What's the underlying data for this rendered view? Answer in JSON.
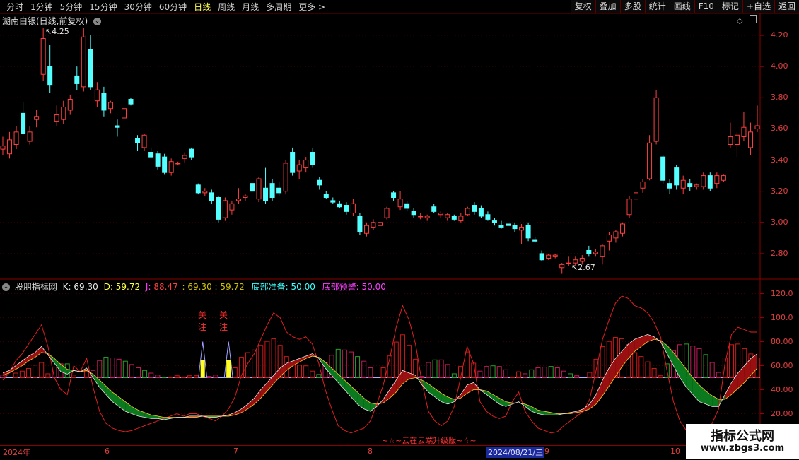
{
  "toolbar": {
    "left_items": [
      "分时",
      "1分钟",
      "5分钟",
      "15分钟",
      "30分钟",
      "60分钟",
      "日线",
      "周线",
      "月线",
      "多周期",
      "更多 >"
    ],
    "active_index": 6,
    "right_items": [
      "复权",
      "叠加",
      "多股",
      "统计",
      "画线",
      "F10",
      "标记",
      "+自选",
      "返回"
    ]
  },
  "main_chart": {
    "title": "湖南白银(日线,前复权)",
    "y_ticks": [
      "4.20",
      "4.00",
      "3.80",
      "3.60",
      "3.40",
      "3.20",
      "3.00",
      "2.80"
    ],
    "y_range": [
      2.65,
      4.3
    ],
    "high_mark": "4.25",
    "low_mark": "2.67",
    "colors": {
      "up": "#ff4040",
      "down": "#54ffff"
    }
  },
  "indicator": {
    "name": "股朋指标网",
    "k_label": "K:",
    "k_value": "69.30",
    "d_label": "D:",
    "d_value": "59.72",
    "j_label": "J:",
    "j_value": "88.47",
    "extra": ": 69.30 : 59.72",
    "bottom_prep_label": "底部准备:",
    "bottom_prep_value": "50.00",
    "bottom_warn_label": "底部预警:",
    "bottom_warn_value": "50.00",
    "y_ticks": [
      "120.0",
      "100.0",
      "80.00",
      "60.00",
      "40.00",
      "20.00"
    ],
    "y_range": [
      -5,
      128
    ],
    "signal_text": "关注",
    "footer_text": "~☆~云在云端升级版~☆~"
  },
  "date_axis": {
    "labels": [
      "2024年",
      "6",
      "7",
      "8",
      "9",
      "10"
    ],
    "highlight": "2024/08/21/三"
  },
  "watermark": {
    "title": "指标公式网",
    "url": "www.zbgs3.com"
  },
  "chart_data": {
    "type": "candlestick",
    "series": [
      {
        "o": 3.47,
        "h": 3.55,
        "l": 3.43,
        "c": 3.49
      },
      {
        "o": 3.44,
        "h": 3.58,
        "l": 3.41,
        "c": 3.53
      },
      {
        "o": 3.5,
        "h": 3.62,
        "l": 3.47,
        "c": 3.58
      },
      {
        "o": 3.7,
        "h": 3.77,
        "l": 3.56,
        "c": 3.57
      },
      {
        "o": 3.52,
        "h": 3.62,
        "l": 3.5,
        "c": 3.58
      },
      {
        "o": 3.66,
        "h": 3.72,
        "l": 3.61,
        "c": 3.68
      },
      {
        "o": 3.95,
        "h": 4.25,
        "l": 3.91,
        "c": 4.18
      },
      {
        "o": 4.0,
        "h": 4.14,
        "l": 3.83,
        "c": 3.88
      },
      {
        "o": 3.65,
        "h": 3.75,
        "l": 3.62,
        "c": 3.69
      },
      {
        "o": 3.66,
        "h": 3.78,
        "l": 3.63,
        "c": 3.74
      },
      {
        "o": 3.72,
        "h": 3.82,
        "l": 3.69,
        "c": 3.79
      },
      {
        "o": 3.94,
        "h": 4.0,
        "l": 3.85,
        "c": 3.89
      },
      {
        "o": 3.87,
        "h": 4.25,
        "l": 3.84,
        "c": 4.19
      },
      {
        "o": 4.11,
        "h": 4.2,
        "l": 3.85,
        "c": 3.87
      },
      {
        "o": 3.78,
        "h": 3.9,
        "l": 3.74,
        "c": 3.85
      },
      {
        "o": 3.83,
        "h": 3.87,
        "l": 3.68,
        "c": 3.72
      },
      {
        "o": 3.73,
        "h": 3.78,
        "l": 3.7,
        "c": 3.77
      },
      {
        "o": 3.62,
        "h": 3.66,
        "l": 3.55,
        "c": 3.61
      },
      {
        "o": 3.67,
        "h": 3.75,
        "l": 3.62,
        "c": 3.73
      },
      {
        "o": 3.79,
        "h": 3.8,
        "l": 3.75,
        "c": 3.76
      },
      {
        "o": 3.54,
        "h": 3.56,
        "l": 3.46,
        "c": 3.51
      },
      {
        "o": 3.48,
        "h": 3.57,
        "l": 3.46,
        "c": 3.56
      },
      {
        "o": 3.45,
        "h": 3.48,
        "l": 3.41,
        "c": 3.42
      },
      {
        "o": 3.44,
        "h": 3.46,
        "l": 3.34,
        "c": 3.36
      },
      {
        "o": 3.42,
        "h": 3.44,
        "l": 3.31,
        "c": 3.32
      },
      {
        "o": 3.32,
        "h": 3.41,
        "l": 3.3,
        "c": 3.39
      },
      {
        "o": 3.38,
        "h": 3.39,
        "l": 3.37,
        "c": 3.38
      },
      {
        "o": 3.41,
        "h": 3.45,
        "l": 3.38,
        "c": 3.43
      },
      {
        "o": 3.47,
        "h": 3.48,
        "l": 3.4,
        "c": 3.42
      },
      {
        "o": 3.24,
        "h": 3.25,
        "l": 3.18,
        "c": 3.19
      },
      {
        "o": 3.19,
        "h": 3.22,
        "l": 3.17,
        "c": 3.2
      },
      {
        "o": 3.19,
        "h": 3.21,
        "l": 3.12,
        "c": 3.14
      },
      {
        "o": 3.16,
        "h": 3.17,
        "l": 3.0,
        "c": 3.02
      },
      {
        "o": 3.03,
        "h": 3.16,
        "l": 3.01,
        "c": 3.14
      },
      {
        "o": 3.08,
        "h": 3.14,
        "l": 3.05,
        "c": 3.12
      },
      {
        "o": 3.14,
        "h": 3.22,
        "l": 3.12,
        "c": 3.15
      },
      {
        "o": 3.16,
        "h": 3.18,
        "l": 3.14,
        "c": 3.17
      },
      {
        "o": 3.25,
        "h": 3.28,
        "l": 3.17,
        "c": 3.2
      },
      {
        "o": 3.15,
        "h": 3.29,
        "l": 3.13,
        "c": 3.28
      },
      {
        "o": 3.22,
        "h": 3.35,
        "l": 3.12,
        "c": 3.14
      },
      {
        "o": 3.25,
        "h": 3.28,
        "l": 3.14,
        "c": 3.16
      },
      {
        "o": 3.22,
        "h": 3.26,
        "l": 3.17,
        "c": 3.19
      },
      {
        "o": 3.2,
        "h": 3.4,
        "l": 3.18,
        "c": 3.38
      },
      {
        "o": 3.45,
        "h": 3.48,
        "l": 3.3,
        "c": 3.32
      },
      {
        "o": 3.33,
        "h": 3.4,
        "l": 3.28,
        "c": 3.37
      },
      {
        "o": 3.35,
        "h": 3.42,
        "l": 3.32,
        "c": 3.4
      },
      {
        "o": 3.45,
        "h": 3.48,
        "l": 3.35,
        "c": 3.37
      },
      {
        "o": 3.27,
        "h": 3.29,
        "l": 3.21,
        "c": 3.24
      },
      {
        "o": 3.18,
        "h": 3.2,
        "l": 3.15,
        "c": 3.16
      },
      {
        "o": 3.14,
        "h": 3.16,
        "l": 3.12,
        "c": 3.13
      },
      {
        "o": 3.12,
        "h": 3.14,
        "l": 3.09,
        "c": 3.1
      },
      {
        "o": 3.11,
        "h": 3.13,
        "l": 3.05,
        "c": 3.07
      },
      {
        "o": 3.06,
        "h": 3.15,
        "l": 3.04,
        "c": 3.12
      },
      {
        "o": 3.04,
        "h": 3.06,
        "l": 2.92,
        "c": 2.94
      },
      {
        "o": 2.93,
        "h": 3.0,
        "l": 2.91,
        "c": 2.98
      },
      {
        "o": 2.97,
        "h": 3.02,
        "l": 2.95,
        "c": 3.0
      },
      {
        "o": 2.98,
        "h": 3.01,
        "l": 2.96,
        "c": 3.0
      },
      {
        "o": 3.03,
        "h": 3.1,
        "l": 3.02,
        "c": 3.09
      },
      {
        "o": 3.19,
        "h": 3.2,
        "l": 3.14,
        "c": 3.16
      },
      {
        "o": 3.1,
        "h": 3.2,
        "l": 3.08,
        "c": 3.15
      },
      {
        "o": 3.12,
        "h": 3.14,
        "l": 3.07,
        "c": 3.09
      },
      {
        "o": 3.07,
        "h": 3.09,
        "l": 3.03,
        "c": 3.05
      },
      {
        "o": 3.04,
        "h": 3.06,
        "l": 3.02,
        "c": 3.04
      },
      {
        "o": 3.03,
        "h": 3.05,
        "l": 3.01,
        "c": 3.04
      },
      {
        "o": 3.1,
        "h": 3.12,
        "l": 3.06,
        "c": 3.07
      },
      {
        "o": 3.05,
        "h": 3.07,
        "l": 3.03,
        "c": 3.06
      },
      {
        "o": 3.03,
        "h": 3.06,
        "l": 3.01,
        "c": 3.05
      },
      {
        "o": 3.04,
        "h": 3.05,
        "l": 3.01,
        "c": 3.02
      },
      {
        "o": 3.01,
        "h": 3.06,
        "l": 3.0,
        "c": 3.04
      },
      {
        "o": 3.05,
        "h": 3.1,
        "l": 3.04,
        "c": 3.09
      },
      {
        "o": 3.11,
        "h": 3.13,
        "l": 3.05,
        "c": 3.07
      },
      {
        "o": 3.09,
        "h": 3.11,
        "l": 3.03,
        "c": 3.04
      },
      {
        "o": 3.05,
        "h": 3.07,
        "l": 3.01,
        "c": 3.02
      },
      {
        "o": 3.01,
        "h": 3.03,
        "l": 2.98,
        "c": 3.0
      },
      {
        "o": 2.98,
        "h": 3.01,
        "l": 2.96,
        "c": 2.97
      },
      {
        "o": 2.99,
        "h": 3.0,
        "l": 2.97,
        "c": 2.98
      },
      {
        "o": 2.98,
        "h": 3.0,
        "l": 2.94,
        "c": 2.96
      },
      {
        "o": 2.95,
        "h": 2.99,
        "l": 2.86,
        "c": 2.97
      },
      {
        "o": 2.98,
        "h": 3.0,
        "l": 2.88,
        "c": 2.9
      },
      {
        "o": 2.89,
        "h": 2.91,
        "l": 2.87,
        "c": 2.88
      },
      {
        "o": 2.8,
        "h": 2.82,
        "l": 2.75,
        "c": 2.76
      },
      {
        "o": 2.77,
        "h": 2.8,
        "l": 2.76,
        "c": 2.79
      },
      {
        "o": 2.78,
        "h": 2.8,
        "l": 2.77,
        "c": 2.79
      },
      {
        "o": 2.71,
        "h": 2.74,
        "l": 2.67,
        "c": 2.73
      },
      {
        "o": 2.74,
        "h": 2.78,
        "l": 2.72,
        "c": 2.74
      },
      {
        "o": 2.74,
        "h": 2.78,
        "l": 2.72,
        "c": 2.76
      },
      {
        "o": 2.75,
        "h": 2.79,
        "l": 2.73,
        "c": 2.77
      },
      {
        "o": 2.82,
        "h": 2.85,
        "l": 2.78,
        "c": 2.8
      },
      {
        "o": 2.8,
        "h": 2.83,
        "l": 2.78,
        "c": 2.81
      },
      {
        "o": 2.78,
        "h": 2.86,
        "l": 2.73,
        "c": 2.85
      },
      {
        "o": 2.88,
        "h": 2.94,
        "l": 2.82,
        "c": 2.92
      },
      {
        "o": 2.9,
        "h": 2.95,
        "l": 2.87,
        "c": 2.94
      },
      {
        "o": 2.93,
        "h": 3.0,
        "l": 2.91,
        "c": 2.99
      },
      {
        "o": 3.05,
        "h": 3.17,
        "l": 3.03,
        "c": 3.15
      },
      {
        "o": 3.15,
        "h": 3.23,
        "l": 3.12,
        "c": 3.19
      },
      {
        "o": 3.22,
        "h": 3.28,
        "l": 3.19,
        "c": 3.26
      },
      {
        "o": 3.28,
        "h": 3.56,
        "l": 3.27,
        "c": 3.51
      },
      {
        "o": 3.52,
        "h": 3.85,
        "l": 3.5,
        "c": 3.8
      },
      {
        "o": 3.42,
        "h": 3.43,
        "l": 3.25,
        "c": 3.27
      },
      {
        "o": 3.25,
        "h": 3.28,
        "l": 3.18,
        "c": 3.22
      },
      {
        "o": 3.35,
        "h": 3.37,
        "l": 3.21,
        "c": 3.24
      },
      {
        "o": 3.22,
        "h": 3.3,
        "l": 3.18,
        "c": 3.27
      },
      {
        "o": 3.25,
        "h": 3.28,
        "l": 3.2,
        "c": 3.23
      },
      {
        "o": 3.23,
        "h": 3.25,
        "l": 3.21,
        "c": 3.24
      },
      {
        "o": 3.23,
        "h": 3.32,
        "l": 3.21,
        "c": 3.3
      },
      {
        "o": 3.3,
        "h": 3.32,
        "l": 3.2,
        "c": 3.22
      },
      {
        "o": 3.25,
        "h": 3.32,
        "l": 3.22,
        "c": 3.3
      },
      {
        "o": 3.27,
        "h": 3.31,
        "l": 3.26,
        "c": 3.3
      },
      {
        "o": 3.5,
        "h": 3.64,
        "l": 3.48,
        "c": 3.55
      },
      {
        "o": 3.5,
        "h": 3.58,
        "l": 3.42,
        "c": 3.56
      },
      {
        "o": 3.55,
        "h": 3.71,
        "l": 3.52,
        "c": 3.61
      },
      {
        "o": 3.48,
        "h": 3.64,
        "l": 3.43,
        "c": 3.58
      },
      {
        "o": 3.6,
        "h": 3.75,
        "l": 3.58,
        "c": 3.62
      }
    ],
    "indicator": {
      "K_start": 54,
      "D_start": 53,
      "K": [
        54,
        56,
        60,
        64,
        68,
        71,
        76,
        69,
        62,
        55,
        53,
        56,
        55,
        58,
        50,
        42,
        36,
        30,
        26,
        22,
        20,
        18,
        17,
        16,
        16,
        15,
        16,
        17,
        17,
        18,
        18,
        18,
        17,
        17,
        18,
        19,
        21,
        24,
        28,
        33,
        40,
        46,
        52,
        58,
        62,
        64,
        66,
        68,
        70,
        66,
        58,
        52,
        46,
        40,
        34,
        28,
        24,
        22,
        26,
        32,
        40,
        48,
        56,
        54,
        52,
        44,
        38,
        34,
        30,
        28,
        30,
        36,
        44,
        46,
        40,
        36,
        32,
        28,
        26,
        28,
        30,
        26,
        22,
        20,
        19,
        19,
        19,
        20,
        21,
        22,
        24,
        28,
        36,
        48,
        58,
        66,
        72,
        78,
        82,
        84,
        86,
        84,
        80,
        70,
        60,
        50,
        42,
        36,
        30,
        28,
        26,
        26,
        36,
        46,
        54,
        60,
        66,
        70
      ],
      "D": [
        52,
        54,
        57,
        60,
        64,
        67,
        71,
        70,
        66,
        61,
        57,
        56,
        55,
        56,
        53,
        48,
        43,
        38,
        34,
        30,
        26,
        23,
        21,
        19,
        18,
        17,
        17,
        17,
        17,
        17,
        17,
        18,
        18,
        18,
        18,
        18,
        19,
        21,
        24,
        28,
        33,
        39,
        45,
        51,
        56,
        60,
        63,
        66,
        68,
        67,
        63,
        58,
        53,
        48,
        43,
        38,
        33,
        29,
        28,
        29,
        33,
        38,
        45,
        49,
        50,
        48,
        45,
        41,
        37,
        34,
        32,
        33,
        37,
        40,
        40,
        39,
        36,
        33,
        30,
        29,
        29,
        28,
        26,
        23,
        22,
        21,
        20,
        20,
        20,
        21,
        22,
        24,
        28,
        35,
        43,
        51,
        59,
        66,
        72,
        76,
        80,
        82,
        81,
        77,
        71,
        64,
        57,
        50,
        44,
        39,
        35,
        32,
        32,
        36,
        41,
        46,
        52,
        58
      ],
      "J": [
        48,
        54,
        64,
        70,
        78,
        86,
        94,
        76,
        50,
        40,
        36,
        60,
        55,
        66,
        42,
        22,
        12,
        8,
        6,
        5,
        6,
        8,
        10,
        12,
        14,
        16,
        18,
        20,
        18,
        20,
        20,
        18,
        16,
        14,
        18,
        24,
        34,
        52,
        62,
        70,
        82,
        94,
        104,
        100,
        88,
        84,
        82,
        84,
        78,
        62,
        40,
        24,
        10,
        6,
        4,
        6,
        8,
        14,
        28,
        44,
        66,
        92,
        110,
        98,
        78,
        46,
        22,
        14,
        10,
        14,
        26,
        50,
        76,
        62,
        30,
        22,
        18,
        16,
        18,
        30,
        38,
        22,
        14,
        8,
        6,
        4,
        5,
        10,
        14,
        18,
        22,
        32,
        56,
        82,
        98,
        112,
        118,
        116,
        110,
        108,
        104,
        96,
        84,
        56,
        30,
        14,
        6,
        2,
        0,
        4,
        12,
        24,
        62,
        86,
        92,
        90,
        88,
        88
      ]
    }
  }
}
